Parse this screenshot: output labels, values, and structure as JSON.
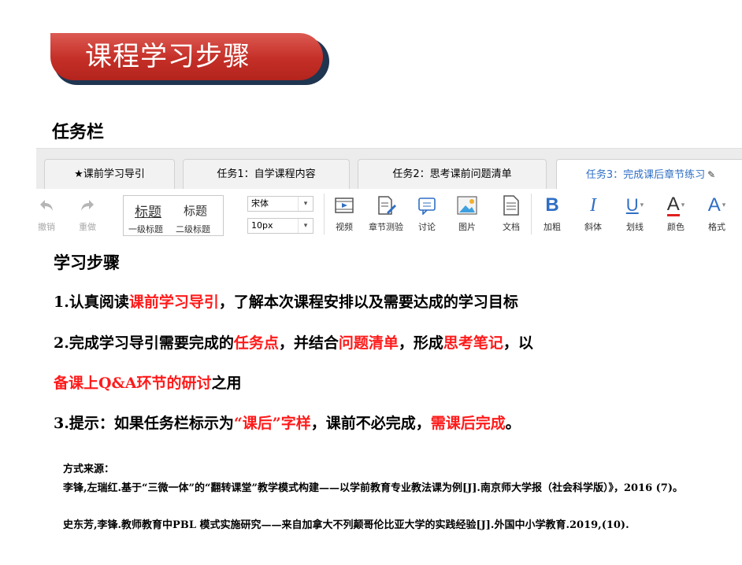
{
  "banner": {
    "title": "课程学习步骤"
  },
  "section": {
    "title": "任务栏"
  },
  "tabs": [
    {
      "label": "★课前学习导引"
    },
    {
      "label": "任务1：自学课程内容"
    },
    {
      "label": "任务2：思考课前问题清单"
    },
    {
      "label": "任务3：完成课后章节练习",
      "active": true
    }
  ],
  "toolbar": {
    "undo": "撤销",
    "redo": "重做",
    "heading1": "标题",
    "heading2": "标题",
    "heading1_sub": "一级标题",
    "heading2_sub": "二级标题",
    "font_family": "宋体",
    "font_size": "10px",
    "video": "视频",
    "chapter_test": "章节测验",
    "discussion": "讨论",
    "image": "图片",
    "document": "文档",
    "bold": "加粗",
    "italic": "斜体",
    "underline": "划线",
    "color": "颜色",
    "format": "格式",
    "bold_glyph": "B",
    "italic_glyph": "I",
    "underline_glyph": "U",
    "color_glyph": "A",
    "format_glyph": "A",
    "accent_color": "#2f6fc5"
  },
  "content": {
    "steps_title": "学习步骤",
    "line1": [
      "1.认真阅读",
      "课前学习导引",
      "，了解本次课程安排以及需要达成的学习目标"
    ],
    "line2": [
      "2.完成学习导引需要完成的",
      "任务点",
      "，并结合",
      "问题清单",
      "，形成",
      "思考笔记",
      "，以"
    ],
    "line3": [
      "备课上Q&A环节的研讨",
      "之用"
    ],
    "line4": [
      "3.提示：如果任务栏标示为",
      "“课后”字样",
      "，课前不必完成，",
      "需课后完成",
      "。"
    ]
  },
  "sources": {
    "title": "方式来源：",
    "refs": [
      "李锋,左瑞红.基于“三微一体”的“翻转课堂”教学模式构建——以学前教育专业教法课为例[J].南京师大学报（社会科学版）》，2016 (7)。",
      "史东芳,李锋.教师教育中PBL 模式实施研究——来自加拿大不列颠哥伦比亚大学的实践经验[J].外国中小学教育.2019,(10)."
    ]
  }
}
